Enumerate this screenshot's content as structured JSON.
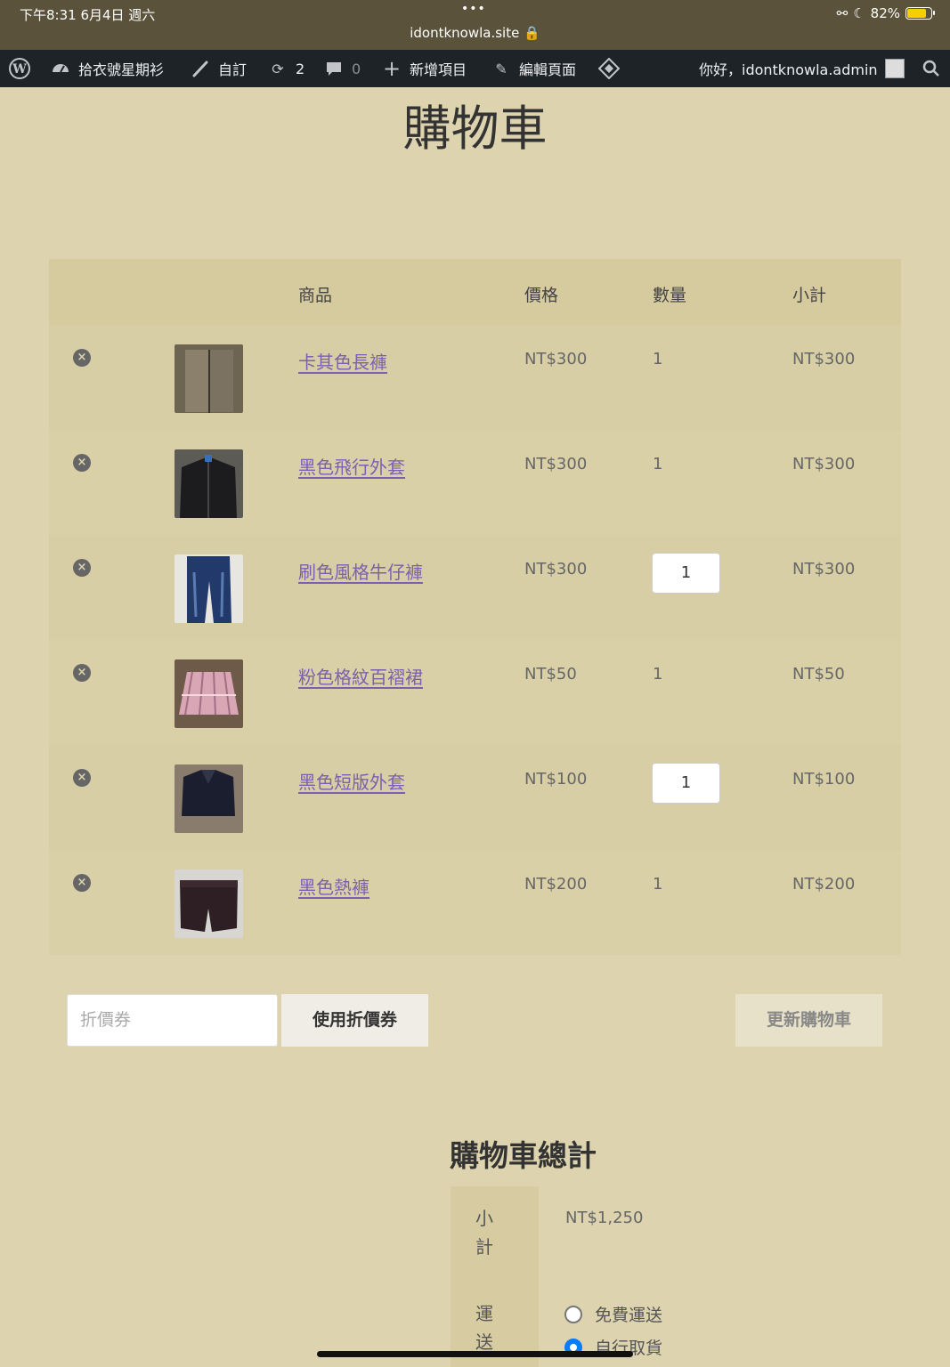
{
  "status_bar": {
    "time": "下午8:31   6月4日 週六",
    "dots": "•••",
    "url": "idontknowla.site 🔒",
    "battery": "82%"
  },
  "admin_bar": {
    "site_name": "拾衣號星期衫",
    "customize": "自訂",
    "updates": "2",
    "comments": "0",
    "new": "新增項目",
    "edit": "編輯頁面",
    "greeting": "你好，idontknowla.admin"
  },
  "page": {
    "title": "購物車"
  },
  "cart": {
    "headers": {
      "product": "商品",
      "price": "價格",
      "quantity": "數量",
      "subtotal": "小計"
    },
    "items": [
      {
        "name": "卡其色長褲",
        "price": "NT$300",
        "qty": "1",
        "subtotal": "NT$300",
        "qty_input": false
      },
      {
        "name": "黑色飛行外套",
        "price": "NT$300",
        "qty": "1",
        "subtotal": "NT$300",
        "qty_input": false
      },
      {
        "name": "刷色風格牛仔褲",
        "price": "NT$300",
        "qty": "1",
        "subtotal": "NT$300",
        "qty_input": true
      },
      {
        "name": "粉色格紋百褶裙",
        "price": "NT$50",
        "qty": "1",
        "subtotal": "NT$50",
        "qty_input": false
      },
      {
        "name": "黑色短版外套",
        "price": "NT$100",
        "qty": "1",
        "subtotal": "NT$100",
        "qty_input": true
      },
      {
        "name": "黑色熱褲",
        "price": "NT$200",
        "qty": "1",
        "subtotal": "NT$200",
        "qty_input": false
      }
    ],
    "remove_icon": "×"
  },
  "actions": {
    "coupon_placeholder": "折價券",
    "apply_coupon": "使用折價券",
    "update_cart": "更新購物車"
  },
  "totals": {
    "title": "購物車總計",
    "subtotal_label_1": "小",
    "subtotal_label_2": "計",
    "subtotal_value": "NT$1,250",
    "shipping_label_1": "運",
    "shipping_label_2": "送",
    "shipping_options": [
      "免費運送",
      "自行取貨"
    ]
  }
}
